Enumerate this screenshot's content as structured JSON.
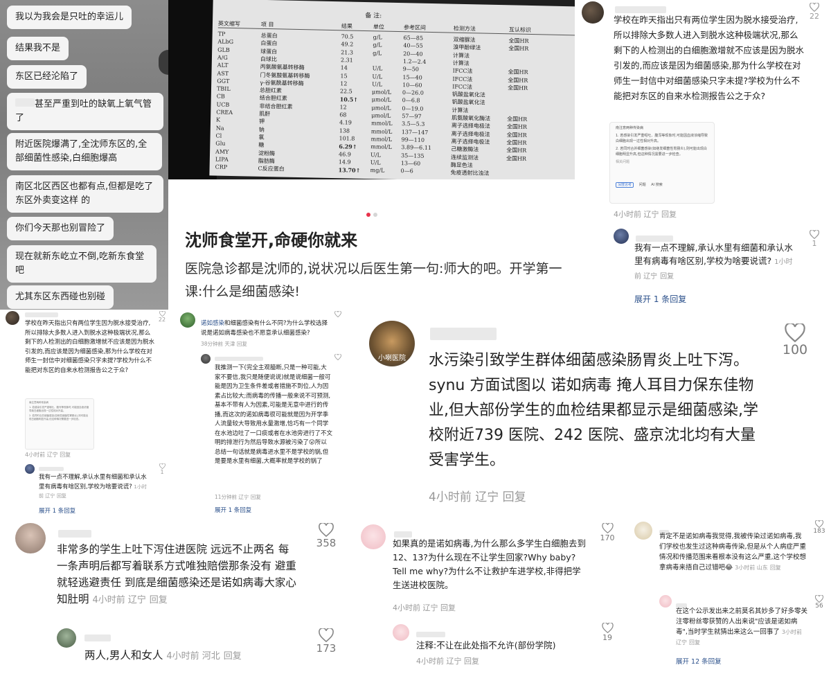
{
  "chat": {
    "messages": [
      "我以为我会是只吐的幸运儿",
      "结果我不是",
      "东区已经沦陷了",
      "甚至严重到吐的缺氧上氧气管了",
      "附近医院爆满了,全沈师东区的,全部细菌性感染,白细胞爆高",
      "南区北区西区也都有点,但都是吃了东区外卖变这样 的",
      "你们今天那也别冒险了",
      "现在就新东屹立不倒,吃新东食堂吧",
      "尤其东区东西碰也别碰"
    ]
  },
  "lab": {
    "headers": [
      "英文缩写",
      "项 目",
      "结果",
      "单位",
      "参考区间",
      "检测方法",
      "互认标识"
    ],
    "note": "备 注:",
    "rows": [
      [
        "TP",
        "总蛋白",
        "70.5",
        "g/L",
        "65—85",
        "双缩脲法",
        "全国HR"
      ],
      [
        "ALbG",
        "白蛋白",
        "49.2",
        "g/L",
        "40—55",
        "溴甲酚绿法",
        "全国HR"
      ],
      [
        "GLB",
        "球蛋白",
        "21.3",
        "g/L",
        "20—40",
        "计算法",
        ""
      ],
      [
        "A/G",
        "白球比",
        "2.31",
        "",
        "1.2—2.4",
        "计算法",
        ""
      ],
      [
        "ALT",
        "丙氨酸氨基转移酶",
        "14",
        "U/L",
        "9—50",
        "IFCC法",
        "全国HR"
      ],
      [
        "AST",
        "门冬氨酸氨基转移酶",
        "15",
        "U/L",
        "15—40",
        "IFCC法",
        "全国HR"
      ],
      [
        "GGT",
        "γ-谷氨酰基转移酶",
        "12",
        "U/L",
        "10—60",
        "IFCC法",
        "全国HR"
      ],
      [
        "TBIL",
        "总胆红素",
        "22.5",
        "μmol/L",
        "0—26.0",
        "钒酸盐氧化法",
        ""
      ],
      [
        "CB",
        "结合胆红素",
        "10.5↑",
        "μmol/L",
        "0—6.8",
        "钒酸盐氧化法",
        ""
      ],
      [
        "UCB",
        "非结合胆红素",
        "12",
        "μmol/L",
        "0—19.0",
        "计算法",
        ""
      ],
      [
        "CREA",
        "肌酐",
        "68",
        "μmol/L",
        "57—97",
        "肌氨酸氧化酶法",
        "全国HR"
      ],
      [
        "K",
        "钾",
        "4.19",
        "mmol/L",
        "3.5—5.3",
        "离子选择电极法",
        "全国HR"
      ],
      [
        "Na",
        "钠",
        "138",
        "mmol/L",
        "137—147",
        "离子选择电极法",
        "全国HR"
      ],
      [
        "Cl",
        "氯",
        "101.8",
        "mmol/L",
        "99—110",
        "离子选择电极法",
        "全国HR"
      ],
      [
        "Glu",
        "糖",
        "6.29↑",
        "mmol/L",
        "3.89—6.11",
        "己糖激酶法",
        "全国HR"
      ],
      [
        "AMY",
        "淀粉酶",
        "46.9",
        "U/L",
        "35—135",
        "连续监测法",
        "全国HR"
      ],
      [
        "LIPA",
        "脂肪酶",
        "14.9",
        "U/L",
        "13—60",
        "酶显色法",
        ""
      ],
      [
        "CRP",
        "C反应蛋白",
        "13.70↑",
        "mg/L",
        "0—6",
        "免疫透射比浊法",
        ""
      ]
    ]
  },
  "post": {
    "title": "沈师食堂开,命硬你就来",
    "body": "医院急诊都是沈师的,说状况以后医生第一句:师大的吧。开学第一课:什么是细菌感染!"
  },
  "c_school": {
    "text": "学校在昨天指出只有两位学生因为脱水接受治疗,所以排除大多数人进入到脱水这种极端状况,那么剩下的人检测出的白细胞激增就不应该是因为脱水引发的,而应该是因为细菌感染,那为什么学校在对师生一封信中对细菌感染只字未提?学校为什么不能把对东区的自来水检测报告公之于众?",
    "likes": "22",
    "meta": "4小时前 辽宁",
    "reply_label": "回复",
    "embed_lines": [
      "南注意两种传染病",
      "1. 若感染引发严重呕吐、腹泻等现象时,可能因血液浓缩导致白细胞出现一过性相对升高。",
      "2. 若同时合并细菌感染(如继发细菌性胃肠炎),则可能出现白细胞明显升高,但这种情况需要进一步检查。",
      "相关问题"
    ],
    "embed_btns": [
      "深度思考",
      "问题",
      "AI 搜索"
    ]
  },
  "c_confuse": {
    "text": "我有一点不理解,承认水里有细菌和承认水里有病毒有啥区别,学校为啥要说谎?",
    "likes": "1",
    "meta": "1小时前 辽宁",
    "reply_label": "回复",
    "expand": "展开 1 条回复"
  },
  "c_nora": {
    "name": "诺如感染",
    "text": "和细菌感染有什么不同?为什么学校选择说是诺如病毒感染也不愿意承认细菌感染?",
    "meta": "38分钟前 天津",
    "reply_label": "回复",
    "reply_text": "我推测一下(完全主观臆断,只是一种可能,大家不要信,我只是随便说说)就是说细菌一般可能是因为卫生条件差或者措施不到位,人为因素占比较大;而病毒的传播一般来说不可预测,基本不带有人为因素,可能是无意中进行的传播,而这次的诺如病毒很可能就是因为开学季人流量较大导致用水量激增,恰巧有一个同学在水池边吐了一口痰或者在水池旁进行了不文明的排泄行为然后导致水源被污染了😮所以总结一句话就是病毒进水里不是学校的锅,但是要是水里有细菌,大概率就是学校的锅了",
    "reply_meta": "11分钟前 辽宁",
    "expand": "展开 1 条回复"
  },
  "c_water": {
    "avatar_text": "小喇医院",
    "text": "水污染引致学生群体细菌感染肠胃炎上吐下泻。synu 方面试图以 诺如病毒 掩人耳目力保东佳物业,但大部份学生的血检结果都显示是细菌感染,学校附近739 医院、242 医院、盛京沈北均有大量受害学生。",
    "likes": "100",
    "meta": "4小时前 辽宁",
    "reply_label": "回复"
  },
  "c_many": {
    "text": "非常多的学生上吐下泻住进医院 远远不止两名 每一条声明后都写着联系方式唯独赔偿那条没有 避重就轻逃避责任 到底是细菌感染还是诺如病毒大家心知肚明",
    "likes": "358",
    "meta": "4小时前 辽宁",
    "reply_label": "回复"
  },
  "c_two": {
    "text": "两人,男人和女人",
    "likes": "173",
    "meta": "4小时前 河北",
    "reply_label": "回复"
  },
  "c_ifnora": {
    "text": "如果真的是诺如病毒,为什么那么多学生白细胞去到12、13?为什么现在不让学生回家?Why baby? Tell me why?为什么不让救护车进学校,非得把学生送进校医院。",
    "likes": "170",
    "meta": "4小时前 辽宁",
    "reply_label": "回复"
  },
  "c_note": {
    "text": "注释:不让在此处指不允许(部份学院)",
    "likes": "19",
    "meta": "4小时前 辽宁",
    "reply_label": "回复"
  },
  "c_sure": {
    "text": "肯定不是诺如病毒我觉得,我被传染过诺如病毒,我们学校也发生过这种病毒传染,但是从个人病症严重情况和传播范围来看根本没有这么严重,这个学校想拿病毒来捂自己过错吧😂",
    "likes": "183",
    "meta": "3小时前 山东",
    "reply_label": "回复"
  },
  "c_notice": {
    "text": "在这个公示发出来之前莫名其妙多了好多零关注零粉丝零获赞的人出来说\"应该是诺如病毒\",当时学生就猜出来这么一回事了",
    "likes": "56",
    "meta": "3小时前 辽宁",
    "reply_label": "回复",
    "expand": "展开 12 条回复"
  }
}
